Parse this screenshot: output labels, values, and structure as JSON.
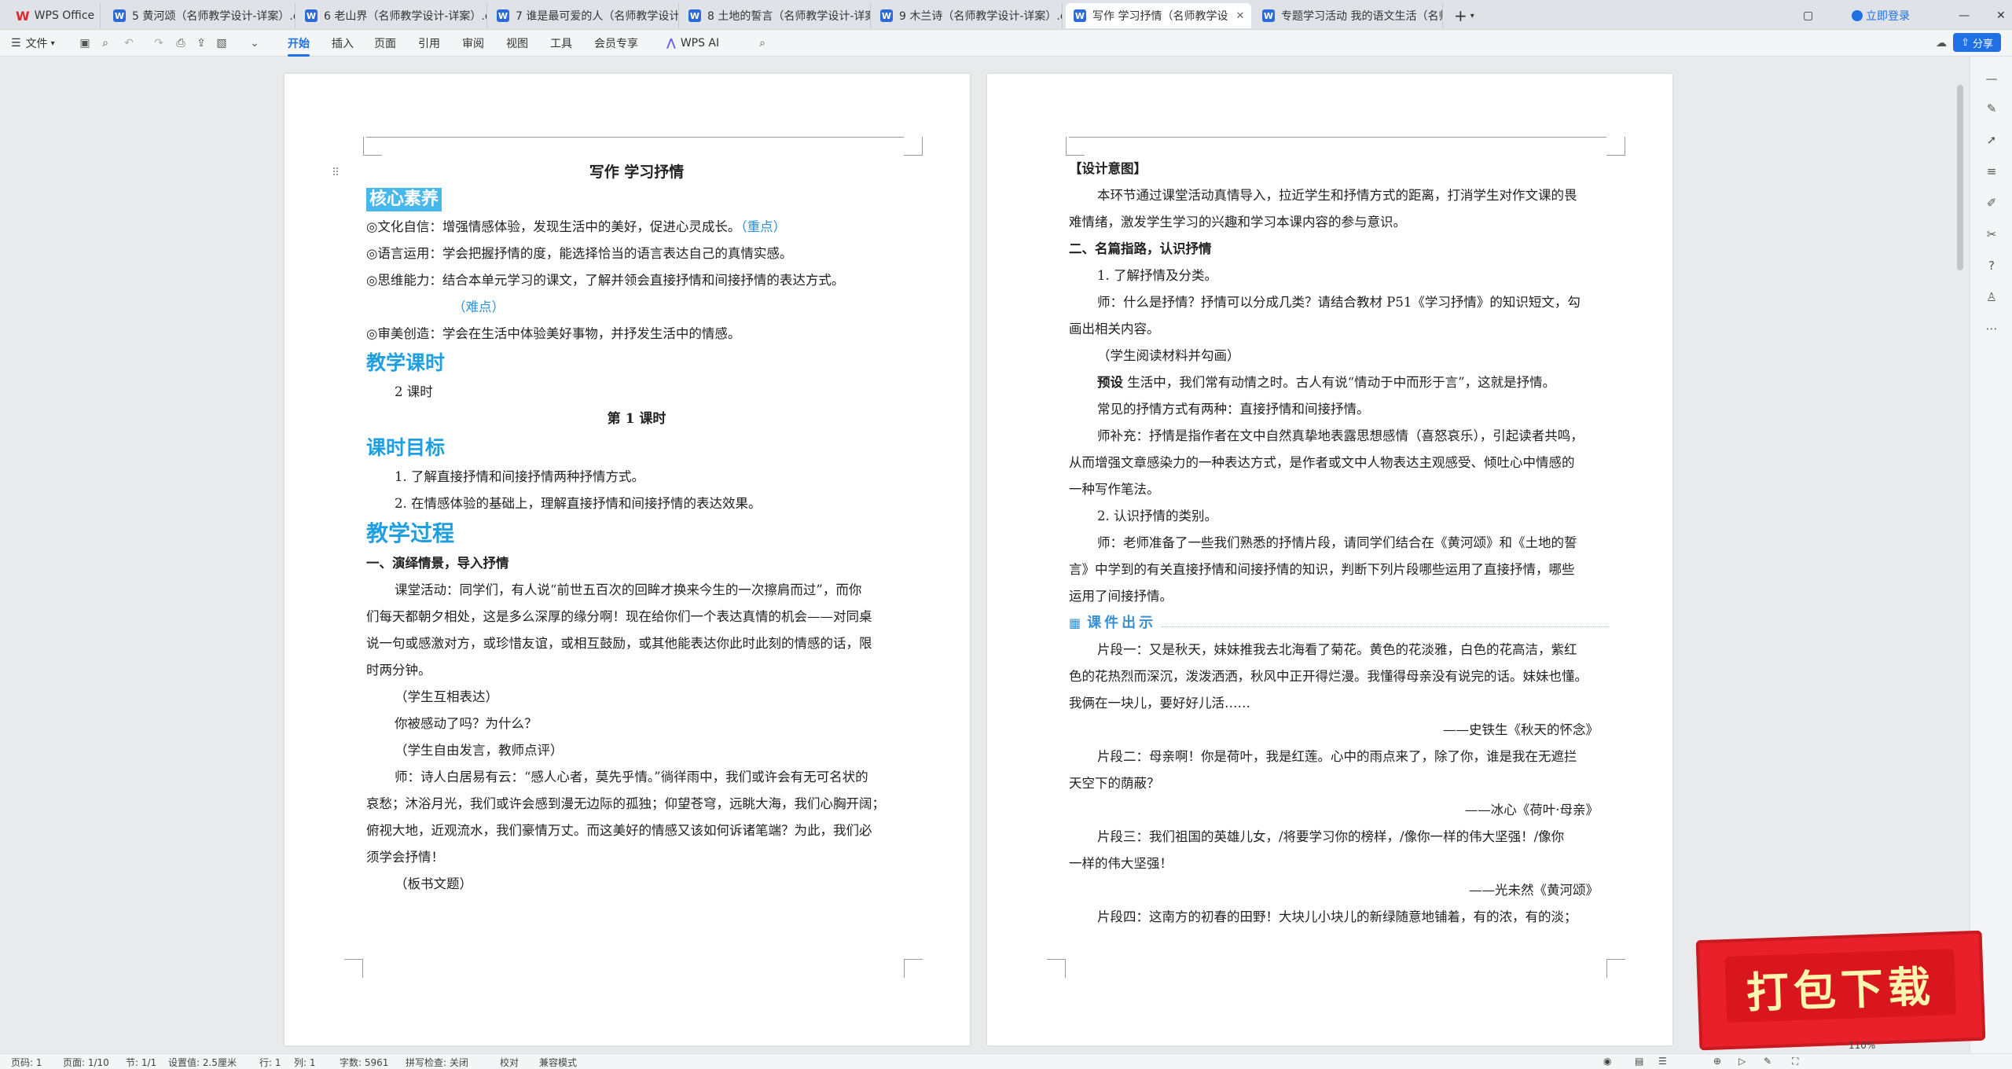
{
  "tabs": [
    {
      "label": "WPS Office",
      "type": "app"
    },
    {
      "label": "5 黄河颂（名师教学设计-详案）.doc"
    },
    {
      "label": "6 老山界（名师教学设计-详案）.doc"
    },
    {
      "label": "7 谁是最可爱的人（名师教学设计-详"
    },
    {
      "label": "8 土地的誓言（名师教学设计-详案）"
    },
    {
      "label": "9 木兰诗（名师教学设计-详案）.doc"
    },
    {
      "label": "写作 学习抒情（名师教学设"
    },
    {
      "label": "专题学习活动 我的语文生活（名师教"
    }
  ],
  "login_label": "立即登录",
  "menu": {
    "file": "文件",
    "tabs": [
      "开始",
      "插入",
      "页面",
      "引用",
      "审阅",
      "视图",
      "工具",
      "会员专享"
    ],
    "ai": "WPS AI",
    "share": "分享"
  },
  "left_page": {
    "title": "写作  学习抒情",
    "h_core": "核心素养",
    "core_items": [
      {
        "text": "◎文化自信：增强情感体验，发现生活中的美好，促进心灵成长。",
        "note": "（重点）"
      },
      {
        "text": "◎语言运用：学会把握抒情的度，能选择恰当的语言表达自己的真情实感。",
        "note": ""
      },
      {
        "text": "◎思维能力：结合本单元学习的课文，了解并领会直接抒情和间接抒情的表达方式。",
        "note": ""
      }
    ],
    "nandian": "（难点）",
    "aesthetic": "◎审美创造：学会在生活中体验美好事物，并抒发生活中的情感。",
    "h_hours": "教学课时",
    "hours": "2 课时",
    "lesson1": "第 1 课时",
    "h_goal": "课时目标",
    "goals": [
      "1. 了解直接抒情和间接抒情两种抒情方式。",
      "2. 在情感体验的基础上，理解直接抒情和间接抒情的表达效果。"
    ],
    "h_process": "教学过程",
    "sec1": "一、演绎情景，导入抒情",
    "para1": [
      "课堂活动：同学们，有人说“前世五百次的回眸才换来今生的一次擦肩而过”，而你",
      "们每天都朝夕相处，这是多么深厚的缘分啊！现在给你们一个表达真情的机会——对同桌",
      "说一句或感激对方，或珍惜友谊，或相互鼓励，或其他能表达你此时此刻的情感的话，限",
      "时两分钟。"
    ],
    "p_student1": "（学生互相表达）",
    "p_q": "你被感动了吗？为什么？",
    "p_student2": "（学生自由发言，教师点评）",
    "para2": [
      "师：诗人白居易有云：“感人心者，莫先乎情。”徜徉雨中，我们或许会有无可名状的",
      "哀愁；沐浴月光，我们或许会感到漫无边际的孤独；仰望苍穹，远眺大海，我们心胸开阔；",
      "俯视大地，近观流水，我们豪情万丈。而这美好的情感又该如何诉诸笔端？为此，我们必",
      "须学会抒情！"
    ],
    "p_board": "（板书文题）"
  },
  "right_page": {
    "design": "【设计意图】",
    "design_text": [
      "本环节通过课堂活动真情导入，拉近学生和抒情方式的距离，打消学生对作文课的畏",
      "难情绪，激发学生学习的兴趣和学习本课内容的参与意识。"
    ],
    "sec2": "二、名篇指路，认识抒情",
    "item1": "1. 了解抒情及分类。",
    "teacher1": [
      "师：什么是抒情？抒情可以分成几类？请结合教材 P51《学习抒情》的知识短文，勾",
      "画出相关内容。"
    ],
    "read": "（学生阅读材料并勾画）",
    "preset_label": "预设",
    "preset": "  生活中，我们常有动情之时。古人有说“情动于中而形于言”，这就是抒情。",
    "common": "常见的抒情方式有两种：直接抒情和间接抒情。",
    "supp": [
      "师补充：抒情是指作者在文中自然真挚地表露思想感情（喜怒哀乐），引起读者共鸣，",
      "从而增强文章感染力的一种表达方式，是作者或文中人物表达主观感受、倾吐心中情感的",
      "一种写作笔法。"
    ],
    "item2": "2. 认识抒情的类别。",
    "teacher2": [
      "师：老师准备了一些我们熟悉的抒情片段，请同学们结合在《黄河颂》和《土地的誓",
      "言》中学到的有关直接抒情和间接抒情的知识，判断下列片段哪些运用了直接抒情，哪些",
      "运用了间接抒情。"
    ],
    "kejian": "课件出示",
    "frag1": [
      "片段一：又是秋天，妹妹推我去北海看了菊花。黄色的花淡雅，白色的花高洁，紫红",
      "色的花热烈而深沉，泼泼洒洒，秋风中正开得烂漫。我懂得母亲没有说完的话。妹妹也懂。",
      "我俩在一块儿，要好好儿活……"
    ],
    "src1": "——史铁生《秋天的怀念》",
    "frag2": [
      "片段二：母亲啊！你是荷叶，我是红莲。心中的雨点来了，除了你，谁是我在无遮拦",
      "天空下的荫蔽？"
    ],
    "src2": "——冰心《荷叶·母亲》",
    "frag3": [
      "片段三：我们祖国的英雄儿女，/将要学习你的榜样，/像你一样的伟大坚强！/像你",
      "一样的伟大坚强！"
    ],
    "src3": "——光未然《黄河颂》",
    "frag4": "片段四：这南方的初春的田野！大块儿小块儿的新绿随意地铺着，有的浓，有的淡；"
  },
  "status": {
    "page": "页码: 1",
    "pages": "页面: 1/10",
    "section": "节: 1/1",
    "setting": "设置值: 2.5厘米",
    "row": "行: 1",
    "col": "列: 1",
    "words": "字数: 5961",
    "spell": "拼写检查: 关闭",
    "proof": "校对",
    "compat": "兼容模式",
    "zoom": "110%"
  },
  "banner_text": "打包下载"
}
